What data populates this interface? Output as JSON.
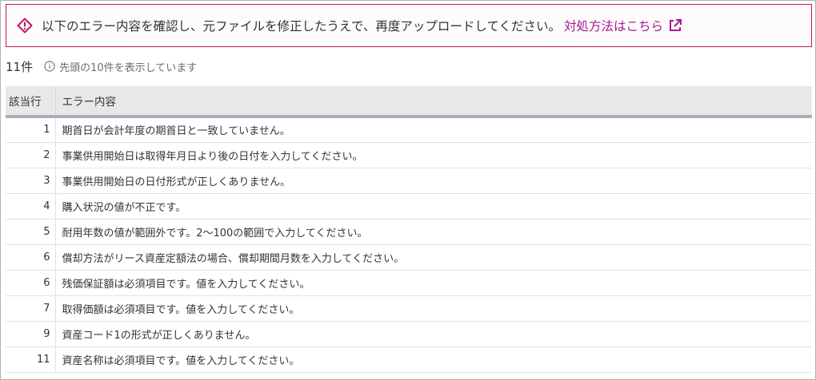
{
  "alert": {
    "message": "以下のエラー内容を確認し、元ファイルを修正したうえで、再度アップロードしてください。",
    "link_label": "対処方法はこちら",
    "colors": {
      "border": "#c2185b",
      "icon": "#c2185b",
      "link": "#a41a91"
    },
    "icons": {
      "warning": "warning-diamond-icon",
      "external": "external-link-icon"
    }
  },
  "summary": {
    "count": "11件",
    "note": "先頭の10件を表示しています",
    "icon": "info-circle-icon"
  },
  "table": {
    "headers": {
      "line": "該当行",
      "message": "エラー内容"
    },
    "rows": [
      {
        "line": "1",
        "message": "期首日が会計年度の期首日と一致していません。"
      },
      {
        "line": "2",
        "message": "事業供用開始日は取得年月日より後の日付を入力してください。"
      },
      {
        "line": "3",
        "message": "事業供用開始日の日付形式が正しくありません。"
      },
      {
        "line": "4",
        "message": "購入状況の値が不正です。"
      },
      {
        "line": "5",
        "message": "耐用年数の値が範囲外です。2〜100の範囲で入力してください。"
      },
      {
        "line": "6",
        "message": "償却方法がリース資産定額法の場合、償却期間月数を入力してください。"
      },
      {
        "line": "6",
        "message": "残価保証額は必須項目です。値を入力してください。"
      },
      {
        "line": "7",
        "message": "取得価額は必須項目です。値を入力してください。"
      },
      {
        "line": "9",
        "message": "資産コード1の形式が正しくありません。"
      },
      {
        "line": "11",
        "message": "資産名称は必須項目です。値を入力してください。"
      }
    ]
  }
}
